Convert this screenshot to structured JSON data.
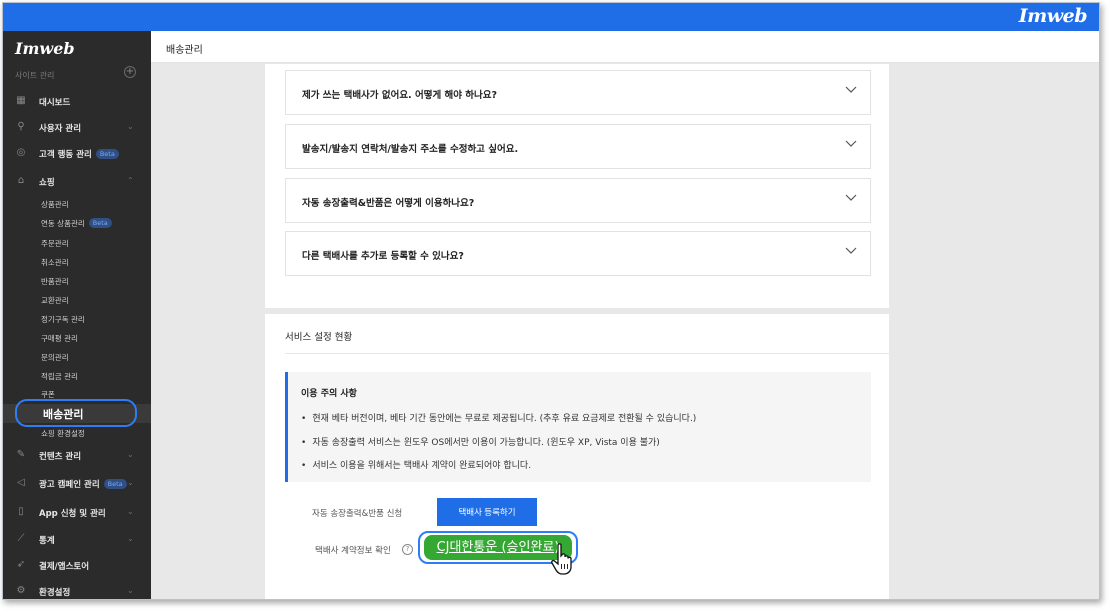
{
  "topbar": {
    "brand": "Imweb"
  },
  "sidebar": {
    "logo": "Imweb",
    "section_label": "사이트 관리",
    "items": [
      {
        "label": "대시보드",
        "icon": "grid-icon"
      },
      {
        "label": "사용자 관리",
        "icon": "user-icon"
      },
      {
        "label": "고객 행동 관리",
        "icon": "target-icon",
        "badge": "Beta"
      },
      {
        "label": "쇼핑",
        "icon": "shopping-bag-icon"
      }
    ],
    "shop_sub_items": [
      {
        "label": "상품관리"
      },
      {
        "label": "연동 상품관리",
        "badge": "Beta"
      },
      {
        "label": "주문관리"
      },
      {
        "label": "취소관리"
      },
      {
        "label": "반품관리"
      },
      {
        "label": "교환관리"
      },
      {
        "label": "정기구독 관리"
      },
      {
        "label": "구매평 관리"
      },
      {
        "label": "문의관리"
      },
      {
        "label": "적립금 관리"
      },
      {
        "label": "쿠폰"
      }
    ],
    "active_item": "배송관리",
    "shop_settings": "쇼핑 환경설정",
    "bottom_items": [
      {
        "label": "컨텐츠 관리",
        "icon": "edit-icon"
      },
      {
        "label": "광고 캠페인 관리",
        "icon": "megaphone-icon",
        "badge": "Beta"
      },
      {
        "label": "App 신청 및 관리",
        "icon": "mobile-icon"
      },
      {
        "label": "통계",
        "icon": "chart-icon"
      },
      {
        "label": "결제/앱스토어",
        "icon": "rocket-icon"
      },
      {
        "label": "환경설정",
        "icon": "gear-icon"
      }
    ]
  },
  "header": {
    "title": "배송관리"
  },
  "faq": [
    {
      "question": "제가 쓰는 택배사가 없어요. 어떻게 해야 하나요?"
    },
    {
      "question": "발송지/발송지 연락처/발송지 주소를 수정하고 싶어요."
    },
    {
      "question": "자동 송장출력&반품은 어떻게 이용하나요?"
    },
    {
      "question": "다른 택배사를 추가로 등록할 수 있나요?"
    }
  ],
  "status": {
    "title": "서비스 설정 현황",
    "notice_title": "이용 주의 사항",
    "notice_items": [
      "현재 베타 버전이며, 베타 기간 동안에는 무료로 제공됩니다. (추후 유료 요금제로 전환될 수 있습니다.)",
      "자동 송장출력 서비스는 윈도우 OS에서만 이용이 가능합니다. (윈도우 XP, Vista 이용 불가)",
      "서비스 이용을 위해서는 택배사 계약이 완료되어야 합니다."
    ],
    "apply_label": "자동 송장출력&반품 신청",
    "apply_button": "택배사 등록하기",
    "contract_label": "택배사 계약정보 확인",
    "contract_link": "CJ대한통운 (승인완료)"
  },
  "colors": {
    "accent": "#1f6ee8",
    "sidebar_bg": "#2b2b2b",
    "success": "#34a832"
  }
}
